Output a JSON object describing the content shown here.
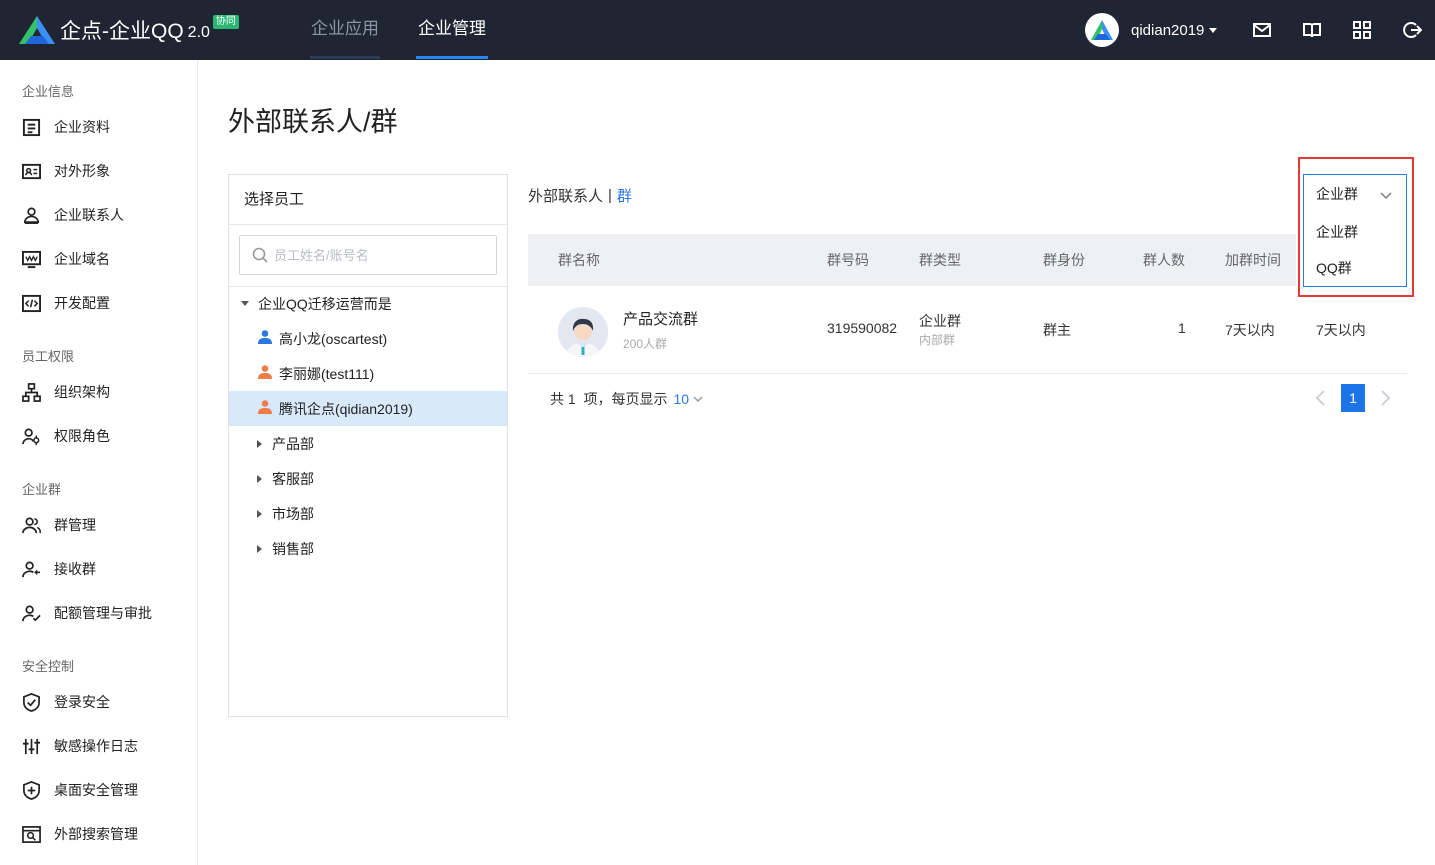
{
  "colors": {
    "topbar": "#1f2533",
    "accent": "#2b78e4",
    "selected_row": "#d8e9fb",
    "highlight": "#e53935",
    "badge": "#2bb673"
  },
  "app": {
    "title": "企点-企业QQ",
    "version": "2.0",
    "badge": "协同"
  },
  "nav": {
    "tabs": [
      {
        "label": "企业应用"
      },
      {
        "label": "企业管理"
      }
    ],
    "active": "企业管理"
  },
  "user": {
    "name": "qidian2019"
  },
  "topbar_icons": [
    "mail-icon",
    "book-icon",
    "apps-grid-icon",
    "logout-icon"
  ],
  "sidebar": {
    "sections": [
      {
        "title": "企业信息",
        "items": [
          {
            "label": "企业资料",
            "icon": "document-icon"
          },
          {
            "label": "对外形象",
            "icon": "id-card-icon"
          },
          {
            "label": "企业联系人",
            "icon": "contact-person-icon"
          },
          {
            "label": "企业域名",
            "icon": "domain-icon"
          },
          {
            "label": "开发配置",
            "icon": "code-icon"
          }
        ]
      },
      {
        "title": "员工权限",
        "items": [
          {
            "label": "组织架构",
            "icon": "org-chart-icon"
          },
          {
            "label": "权限角色",
            "icon": "role-icon"
          }
        ]
      },
      {
        "title": "企业群",
        "items": [
          {
            "label": "群管理",
            "icon": "group-icon"
          },
          {
            "label": "接收群",
            "icon": "receive-group-icon"
          },
          {
            "label": "配额管理与审批",
            "icon": "quota-icon"
          }
        ]
      },
      {
        "title": "安全控制",
        "items": [
          {
            "label": "登录安全",
            "icon": "shield-check-icon"
          },
          {
            "label": "敏感操作日志",
            "icon": "sliders-icon"
          },
          {
            "label": "桌面安全管理",
            "icon": "shield-plus-icon"
          },
          {
            "label": "外部搜索管理",
            "icon": "search-window-icon"
          }
        ]
      }
    ]
  },
  "page": {
    "title": "外部联系人/群"
  },
  "employee_panel": {
    "header": "选择员工",
    "search_placeholder": "员工姓名/账号名",
    "tree": {
      "root": "企业QQ迁移运营而是",
      "members": [
        {
          "label": "高小龙(oscartest)",
          "color": "#2b78e4"
        },
        {
          "label": "李丽娜(test111)",
          "color": "#f07c4a"
        },
        {
          "label": "腾讯企点(qidian2019)",
          "color": "#f07c4a",
          "selected": true
        }
      ],
      "departments": [
        "产品部",
        "客服部",
        "市场部",
        "销售部"
      ]
    }
  },
  "view_tabs": {
    "contacts": "外部联系人",
    "separator": "|",
    "groups": "群"
  },
  "group_type_select": {
    "value": "企业群",
    "options": [
      "企业群",
      "QQ群"
    ]
  },
  "table": {
    "columns": [
      "群名称",
      "群号码",
      "群类型",
      "群身份",
      "群人数",
      "加群时间"
    ],
    "rows": [
      {
        "name": "产品交流群",
        "members_text": "200人群",
        "number": "319590082",
        "type": "企业群",
        "type_sub": "内部群",
        "role": "群主",
        "count": "1",
        "join_time": "7天以内",
        "extra": "7天以内"
      }
    ]
  },
  "pagination": {
    "total_text": "共 1  项，每页显示",
    "page_size": "10",
    "current_page": "1"
  }
}
